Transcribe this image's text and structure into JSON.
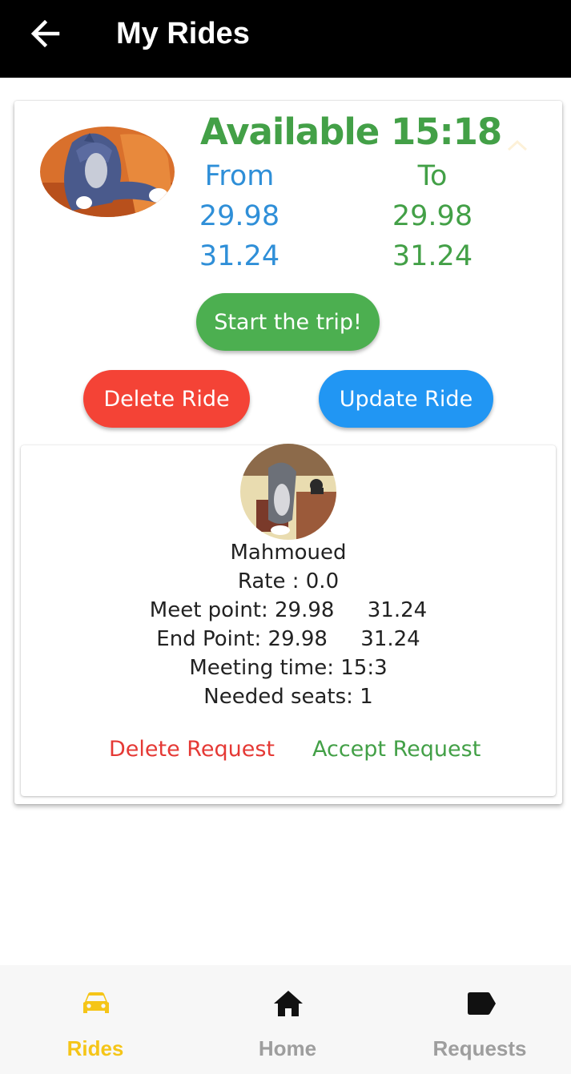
{
  "appbar": {
    "title": "My Rides",
    "back_icon": "arrow-back-icon"
  },
  "ride": {
    "status": "Available 15:18",
    "from_label": "From",
    "to_label": "To",
    "from_lat": "29.98",
    "from_lng": "31.24",
    "to_lat": "29.98",
    "to_lng": "31.24",
    "start_button": "Start the trip!",
    "delete_button": "Delete Ride",
    "update_button": "Update Ride",
    "collapse_icon": "chevron-up-icon"
  },
  "request": {
    "name": "Mahmoued",
    "rate": "Rate : 0.0",
    "meet_point": "Meet point: 29.98     31.24",
    "end_point": "End Point: 29.98     31.24",
    "meeting_time": "Meeting time: 15:3",
    "needed_seats": "Needed seats: 1",
    "delete_request": "Delete Request",
    "accept_request": "Accept Request"
  },
  "nav": {
    "items": [
      {
        "label": "Rides",
        "icon": "car-icon",
        "active": true
      },
      {
        "label": "Home",
        "icon": "home-icon",
        "active": false
      },
      {
        "label": "Requests",
        "icon": "tag-icon",
        "active": false
      }
    ]
  },
  "colors": {
    "appbar_bg": "#000000",
    "available_green": "#43a047",
    "from_blue": "#2f8fd8",
    "start_green": "#4caf50",
    "delete_red": "#f44336",
    "update_blue": "#2196f3",
    "nav_active": "#f5c518",
    "nav_inactive_label": "#9e9e9e"
  }
}
